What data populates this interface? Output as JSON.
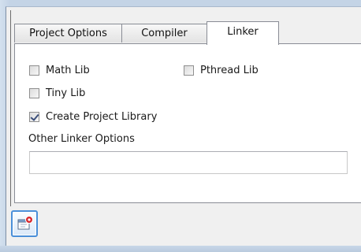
{
  "tabs": [
    {
      "label": "Project Options",
      "active": false
    },
    {
      "label": "Compiler",
      "active": false
    },
    {
      "label": "Linker",
      "active": true
    }
  ],
  "linker": {
    "math_lib": {
      "label": "Math Lib",
      "checked": false
    },
    "pthread_lib": {
      "label": "Pthread Lib",
      "checked": false
    },
    "tiny_lib": {
      "label": "Tiny Lib",
      "checked": false
    },
    "create_project_library": {
      "label": "Create Project Library",
      "checked": true
    },
    "other_options": {
      "label": "Other Linker Options",
      "value": "",
      "placeholder": ""
    }
  },
  "toolbar": {
    "buttons": [
      {
        "icon": "window-close-badge-icon"
      }
    ]
  },
  "colors": {
    "tab_border": "#898c95",
    "button_focus": "#4a8fd9",
    "badge_red": "#d9262b"
  }
}
